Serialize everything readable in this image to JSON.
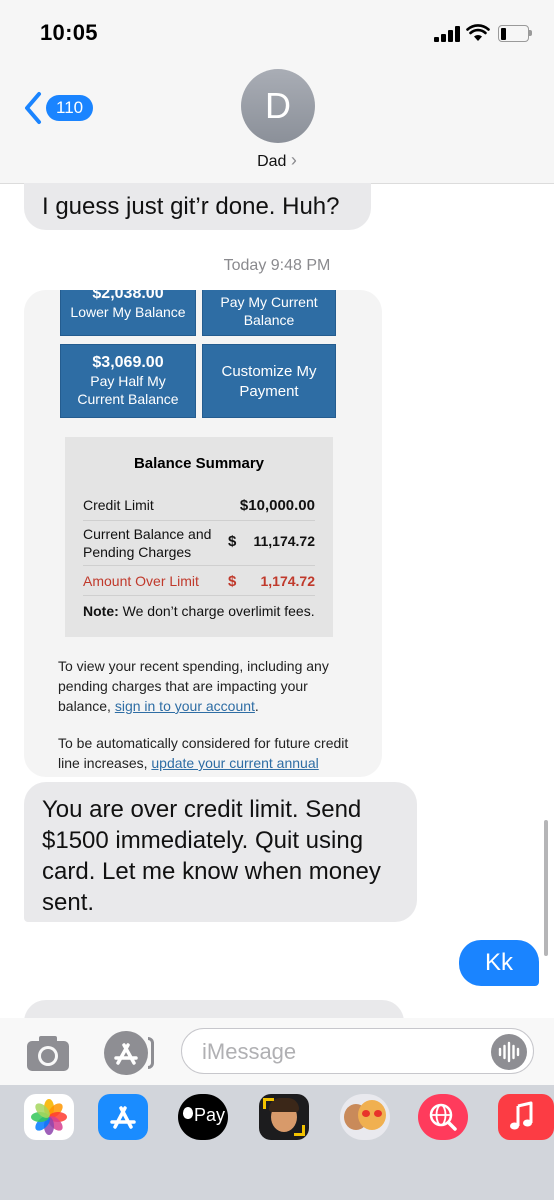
{
  "status_bar": {
    "time": "10:05"
  },
  "header": {
    "back_count": "110",
    "avatar_initial": "D",
    "contact_name": "Dad",
    "contact_chevron": "›"
  },
  "messages": [
    {
      "direction": "incoming",
      "text": "I guess just git’r done. Huh?"
    },
    {
      "direction": "incoming",
      "text": "You are over credit limit. Send $1500 immediately. Quit using card. Let me know when money sent."
    },
    {
      "direction": "outgoing",
      "text": "Kk"
    }
  ],
  "timestamp": "Today 9:48 PM",
  "card_image": {
    "buttons": [
      {
        "amount": "$2,038.00",
        "label": "Lower My Balance"
      },
      {
        "amount": "",
        "label": "Pay My Current Balance"
      },
      {
        "amount": "$3,069.00",
        "label": "Pay Half My Current Balance"
      },
      {
        "amount": "",
        "label": "Customize My Payment"
      }
    ],
    "balance_summary": {
      "title": "Balance Summary",
      "rows": [
        {
          "label": "Credit Limit",
          "currency": "",
          "value": "$10,000.00"
        },
        {
          "label": "Current Balance and Pending Charges",
          "currency": "$",
          "value": "11,174.72"
        },
        {
          "label": "Amount Over Limit",
          "currency": "$",
          "value": "1,174.72"
        }
      ],
      "note_bold": "Note:",
      "note_text": " We don’t charge overlimit fees."
    },
    "paragraph1_text": "To view your recent spending, including any pending charges that are impacting your balance, ",
    "paragraph1_link": "sign in to your account",
    "paragraph1_end": ".",
    "paragraph2_text": "To be automatically considered for future credit line increases, ",
    "paragraph2_link": "update your current annual income amount on file"
  },
  "input_bar": {
    "placeholder": "iMessage"
  },
  "app_drawer": {
    "apps": [
      "photos-icon",
      "app-store-icon",
      "apple-pay-icon",
      "memoji-icon",
      "animoji-icon",
      "web-search-icon",
      "music-icon"
    ],
    "apple_pay_label": "Pay"
  },
  "colors": {
    "imessage_blue": "#1a84ff",
    "incoming_bubble": "#e9e9eb",
    "over_limit_red": "#c0392b",
    "bank_blue": "#2e6da4"
  }
}
